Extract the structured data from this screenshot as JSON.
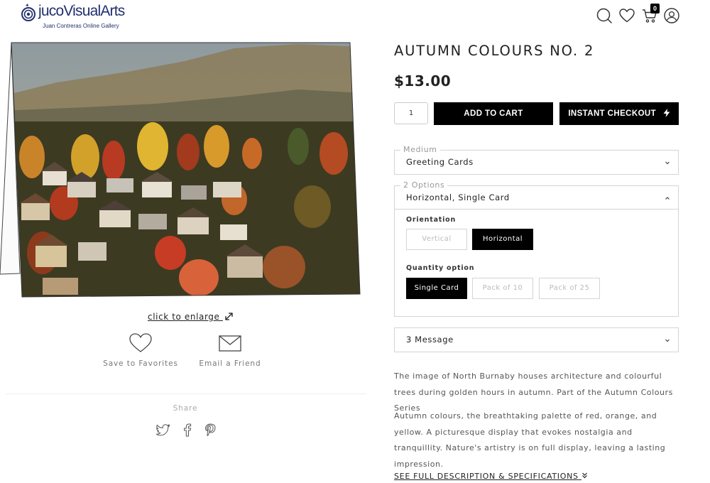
{
  "brand": {
    "name": "jucoVisualArts",
    "tagline": "Juan Contreras Online Gallery",
    "color": "#23306e"
  },
  "header": {
    "icons": [
      "search-icon",
      "heart-icon",
      "cart-icon",
      "user-icon"
    ],
    "cart_count": "0"
  },
  "gallery": {
    "enlarge_label": "click to enlarge",
    "save_label": "Save to Favorites",
    "email_label": "Email a Friend",
    "share_label": "Share",
    "share_icons": [
      "twitter-icon",
      "facebook-icon",
      "pinterest-icon"
    ]
  },
  "product": {
    "title": "AUTUMN COLOURS NO. 2",
    "price": "$13.00",
    "quantity": "1",
    "add_to_cart": "ADD TO CART",
    "instant_checkout": "INSTANT CHECKOUT"
  },
  "medium": {
    "legend": "Medium",
    "value": "Greeting Cards"
  },
  "options": {
    "legend": "2 Options",
    "value": "Horizontal, Single Card",
    "orientation": {
      "label": "Orientation",
      "choices": [
        "Vertical",
        "Horizontal"
      ],
      "selected": "Horizontal"
    },
    "quantity_option": {
      "label": "Quantity option",
      "choices": [
        "Single Card",
        "Pack of 10",
        "Pack of 25"
      ],
      "selected": "Single Card"
    }
  },
  "message": {
    "value": "3 Message"
  },
  "description": {
    "paragraph1": "The image of North Burnaby houses architecture and colourful trees during golden hours in autumn. Part of the Autumn Colours Series",
    "paragraph2": "Autumn colours, the breathtaking palette of red, orange, and yellow. A picturesque display that evokes nostalgia and tranquillity. Nature's artistry is on full display, leaving a lasting impression.",
    "see_full": "SEE FULL DESCRIPTION & SPECIFICATIONS"
  }
}
